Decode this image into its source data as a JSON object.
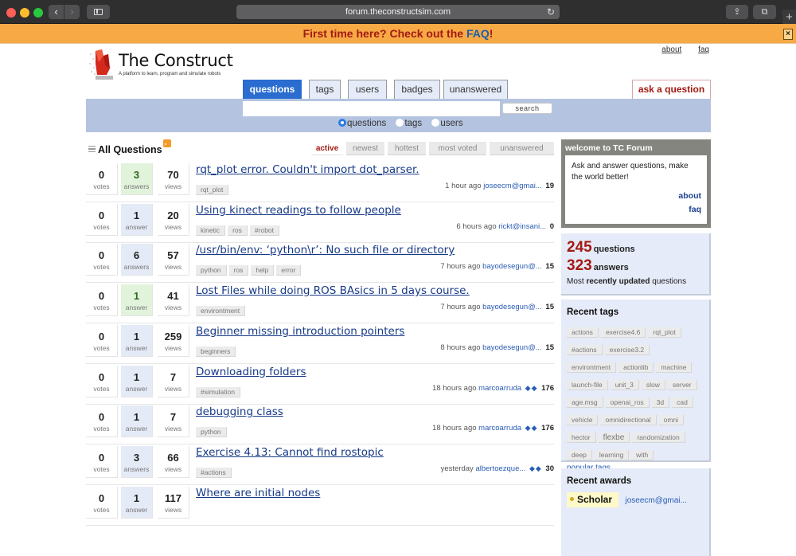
{
  "browser": {
    "url": "forum.theconstructsim.com"
  },
  "notification": {
    "text_before": "First time here? Check out the ",
    "link": "FAQ",
    "text_after": "!",
    "close": "×"
  },
  "header": {
    "logo_title": "The Construct",
    "logo_subtitle": "A platform to learn, program and simulate robots",
    "links": [
      "about",
      "faq"
    ]
  },
  "nav": {
    "tabs": [
      {
        "label": "questions",
        "active": true
      },
      {
        "label": "tags",
        "active": false
      },
      {
        "label": "users",
        "active": false
      },
      {
        "label": "badges",
        "active": false
      },
      {
        "label": "unanswered",
        "active": false
      }
    ],
    "ask": "ask a question"
  },
  "search": {
    "value": "",
    "button": "search",
    "scopes": [
      {
        "label": "questions",
        "selected": true
      },
      {
        "label": "tags",
        "selected": false
      },
      {
        "label": "users",
        "selected": false
      }
    ]
  },
  "list": {
    "title": "All Questions",
    "sorts": [
      {
        "label": "active",
        "active": true
      },
      {
        "label": "newest",
        "active": false
      },
      {
        "label": "hottest",
        "active": false
      },
      {
        "label": "most voted",
        "active": false
      },
      {
        "label": "unanswered",
        "active": false
      }
    ],
    "questions": [
      {
        "votes": "0",
        "votes_label": "votes",
        "answers": "3",
        "answers_label": "answers",
        "accepted": true,
        "views": "70",
        "views_label": "views",
        "title": "rqt_plot error. Couldn't import dot_parser.",
        "tags": [
          "rqt_plot"
        ],
        "time": "1 hour ago",
        "user": "joseecm@gmai...",
        "badges": "",
        "rep": "19"
      },
      {
        "votes": "0",
        "votes_label": "votes",
        "answers": "1",
        "answers_label": "answer",
        "accepted": false,
        "views": "20",
        "views_label": "views",
        "title": "Using kinect readings to follow people",
        "tags": [
          "kinetic",
          "ros",
          "#robot"
        ],
        "time": "6 hours ago",
        "user": "rickt@insani...",
        "badges": "",
        "rep": "0"
      },
      {
        "votes": "0",
        "votes_label": "votes",
        "answers": "6",
        "answers_label": "answers",
        "accepted": false,
        "views": "57",
        "views_label": "views",
        "title": "/usr/bin/env: ‘python\\r’: No such file or directory",
        "tags": [
          "python",
          "ros",
          "help",
          "error"
        ],
        "time": "7 hours ago",
        "user": "bayodesegun@...",
        "badges": "",
        "rep": "15"
      },
      {
        "votes": "0",
        "votes_label": "votes",
        "answers": "1",
        "answers_label": "answer",
        "accepted": true,
        "views": "41",
        "views_label": "views",
        "title": "Lost Files while doing ROS BAsics in 5 days course.",
        "tags": [
          "environtment"
        ],
        "time": "7 hours ago",
        "user": "bayodesegun@...",
        "badges": "",
        "rep": "15"
      },
      {
        "votes": "0",
        "votes_label": "votes",
        "answers": "1",
        "answers_label": "answer",
        "accepted": false,
        "views": "259",
        "views_label": "views",
        "title": "Beginner missing introduction pointers",
        "tags": [
          "beginners"
        ],
        "time": "8 hours ago",
        "user": "bayodesegun@...",
        "badges": "",
        "rep": "15"
      },
      {
        "votes": "0",
        "votes_label": "votes",
        "answers": "1",
        "answers_label": "answer",
        "accepted": false,
        "views": "7",
        "views_label": "views",
        "title": "Downloading folders",
        "tags": [
          "#simulation"
        ],
        "time": "18 hours ago",
        "user": "marcoarruda",
        "badges": "◆◆",
        "rep": "176"
      },
      {
        "votes": "0",
        "votes_label": "votes",
        "answers": "1",
        "answers_label": "answer",
        "accepted": false,
        "views": "7",
        "views_label": "views",
        "title": "debugging class",
        "tags": [
          "python"
        ],
        "time": "18 hours ago",
        "user": "marcoarruda",
        "badges": "◆◆",
        "rep": "176"
      },
      {
        "votes": "0",
        "votes_label": "votes",
        "answers": "3",
        "answers_label": "answers",
        "accepted": false,
        "views": "66",
        "views_label": "views",
        "title": "Exercise 4.13: Cannot find rostopic",
        "tags": [
          "#actions"
        ],
        "time": "yesterday",
        "user": "albertoezque...",
        "badges": "◆◆",
        "rep": "30"
      },
      {
        "votes": "0",
        "votes_label": "votes",
        "answers": "1",
        "answers_label": "answer",
        "accepted": false,
        "views": "117",
        "views_label": "views",
        "title": "Where are initial nodes",
        "tags": [],
        "time": "",
        "user": "",
        "badges": "",
        "rep": ""
      }
    ]
  },
  "sidebar": {
    "welcome": {
      "title": "welcome to TC Forum",
      "body": "Ask and answer questions, make the world better!",
      "links": [
        "about",
        "faq"
      ]
    },
    "stats": {
      "questions_count": "245",
      "questions_label": "questions",
      "answers_count": "323",
      "answers_label": "answers",
      "note_prefix": "Most ",
      "note_bold": "recently updated",
      "note_suffix": " questions"
    },
    "recent_tags": {
      "title": "Recent tags",
      "tags": [
        "actions",
        "exercise4.6",
        "rqt_plot",
        "#actions",
        "exercise3.2",
        "environtment",
        "actionlib",
        "machine",
        "launch-file",
        "unit_3",
        "slow",
        "server",
        "age.msg",
        "openai_ros",
        "3d",
        "cad",
        "vehicle",
        "omnidirectional",
        "omni",
        "hector",
        "flexbe",
        "randomization",
        "deep",
        "learning",
        "with"
      ],
      "popular_link": "popular tags"
    },
    "recent_awards": {
      "title": "Recent awards",
      "awards": [
        {
          "badge": "Scholar",
          "user": "joseecm@gmai..."
        }
      ]
    }
  }
}
